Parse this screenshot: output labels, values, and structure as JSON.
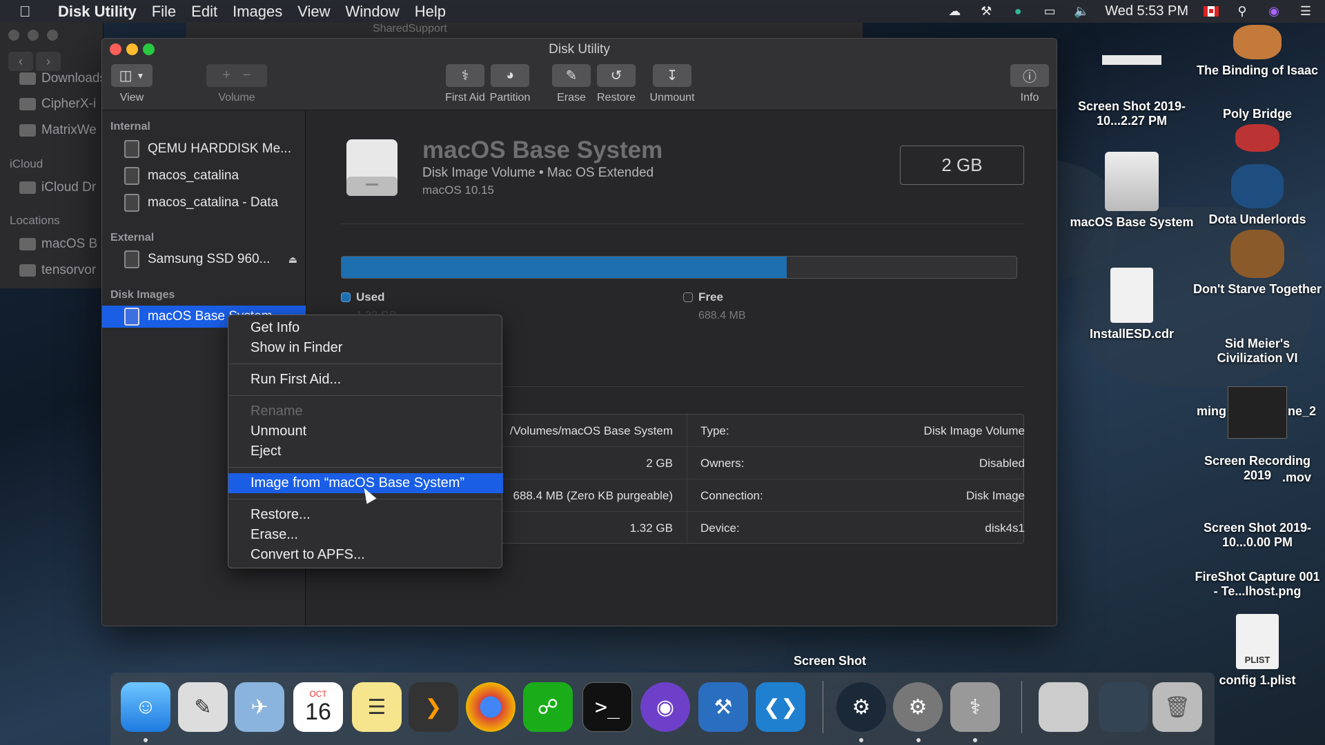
{
  "menubar": {
    "app": "Disk Utility",
    "items": [
      "File",
      "Edit",
      "Images",
      "View",
      "Window",
      "Help"
    ],
    "clock": "Wed 5:53 PM",
    "status_icons": [
      "creative-cloud-icon",
      "tools-icon",
      "browser-icon",
      "airplay-icon",
      "volume-icon",
      "flag-icon",
      "search-icon",
      "siri-icon",
      "notification-center-icon"
    ]
  },
  "finder_bg": {
    "path_label": "SharedSupport",
    "favorites": [
      "Downloads",
      "CipherX-i",
      "MatrixWe"
    ],
    "icloud_head": "iCloud",
    "icloud_items": [
      "iCloud Dr"
    ],
    "locations_head": "Locations",
    "locations_items": [
      "macOS B",
      "tensorvor"
    ]
  },
  "window": {
    "title": "Disk Utility",
    "toolbar": {
      "view": "View",
      "volume": "Volume",
      "first_aid": "First Aid",
      "partition": "Partition",
      "erase": "Erase",
      "restore": "Restore",
      "unmount": "Unmount",
      "info": "Info"
    },
    "sidebar": {
      "internal_head": "Internal",
      "internal": [
        "QEMU HARDDISK Me...",
        "macos_catalina",
        "macos_catalina - Data"
      ],
      "external_head": "External",
      "external": [
        "Samsung SSD 960..."
      ],
      "images_head": "Disk Images",
      "images": [
        "macOS Base System"
      ]
    },
    "volume": {
      "name": "macOS Base System",
      "subtitle": "Disk Image Volume • Mac OS Extended",
      "os": "macOS 10.15",
      "size": "2 GB",
      "used_label": "Used",
      "used_value": "1.32 GB",
      "used_fraction": 0.66,
      "free_label": "Free",
      "free_value": "688.4 MB"
    },
    "info": {
      "rows": [
        {
          "lv": "/Volumes/macOS Base System",
          "rk": "Type:",
          "rv": "Disk Image Volume"
        },
        {
          "lv": "2 GB",
          "rk": "Owners:",
          "rv": "Disabled"
        },
        {
          "lv": "688.4 MB (Zero KB purgeable)",
          "rk": "Connection:",
          "rv": "Disk Image"
        },
        {
          "lv": "1.32 GB",
          "rk": "Device:",
          "rv": "disk4s1"
        }
      ]
    }
  },
  "context_menu": {
    "get_info": "Get Info",
    "show_in_finder": "Show in Finder",
    "run_first_aid": "Run First Aid...",
    "rename": "Rename",
    "unmount": "Unmount",
    "eject": "Eject",
    "image_from": "Image from “macOS Base System”",
    "restore": "Restore...",
    "erase": "Erase...",
    "convert": "Convert to APFS..."
  },
  "desktop": {
    "screen_shot_1": "Screen Shot 2019-10...2.27 PM",
    "macos_base": "macOS Base System",
    "installesd": "InstallESD.cdr",
    "binding": "The Binding of Isaac",
    "poly": "Poly Bridge",
    "dota": "Dota Underlords",
    "dont_starve": "Don't Starve Together",
    "civ": "Sid Meier's Civilization VI",
    "ming": "ming",
    "ne2": "ne_2",
    "screen_rec": "Screen Recording 2019",
    "mov": ".mov",
    "screen_shot_2": "Screen Shot 2019-10...0.00 PM",
    "fireshot": "FireShot Capture 001 - Te...lhost.png",
    "plist_badge": "PLIST",
    "config": "config 1.plist",
    "screen_shot_3": "Screen Shot",
    "calendar_month": "OCT",
    "calendar_day": "16"
  },
  "colors": {
    "accent": "#1a5ee6",
    "used_bar": "#1d6fb0"
  }
}
